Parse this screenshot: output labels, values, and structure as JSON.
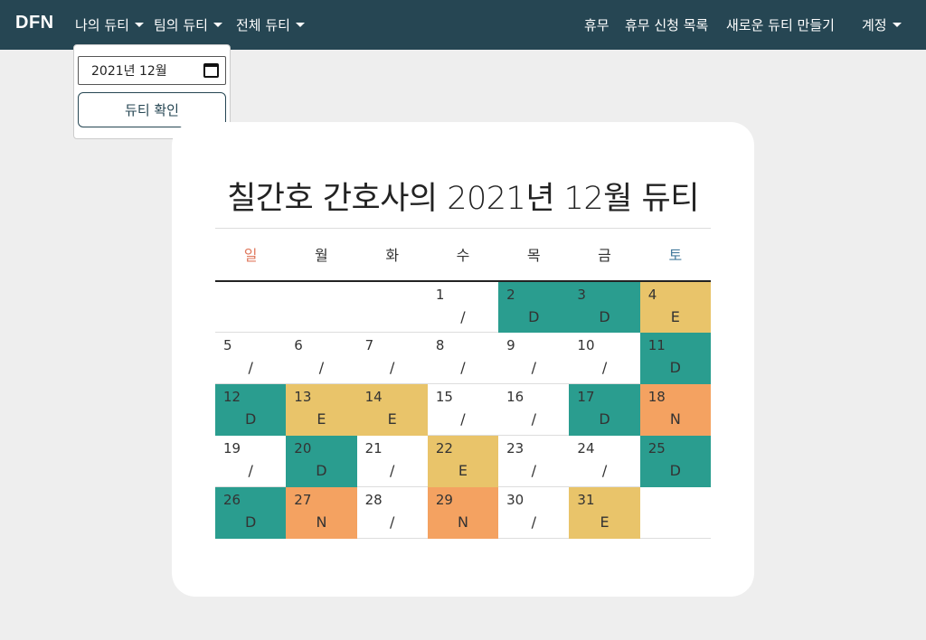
{
  "nav": {
    "brand": "DFN",
    "menus": [
      "나의 듀티",
      "팀의 듀티",
      "전체 듀티"
    ],
    "right_links": [
      "휴무",
      "휴무 신청 목록",
      "새로운 듀티 만들기"
    ],
    "account": "계정"
  },
  "dropdown": {
    "date_value": "2021년 12월",
    "button": "듀티 확인"
  },
  "calendar": {
    "title": "칠간호 간호사의 2021년 12월 듀티",
    "weekdays": [
      "일",
      "월",
      "화",
      "수",
      "목",
      "금",
      "토"
    ],
    "weeks": [
      [
        null,
        null,
        null,
        {
          "day": "1",
          "duty": "/"
        },
        {
          "day": "2",
          "duty": "D"
        },
        {
          "day": "3",
          "duty": "D"
        },
        {
          "day": "4",
          "duty": "E"
        }
      ],
      [
        {
          "day": "5",
          "duty": "/"
        },
        {
          "day": "6",
          "duty": "/"
        },
        {
          "day": "7",
          "duty": "/"
        },
        {
          "day": "8",
          "duty": "/"
        },
        {
          "day": "9",
          "duty": "/"
        },
        {
          "day": "10",
          "duty": "/"
        },
        {
          "day": "11",
          "duty": "D"
        }
      ],
      [
        {
          "day": "12",
          "duty": "D"
        },
        {
          "day": "13",
          "duty": "E"
        },
        {
          "day": "14",
          "duty": "E"
        },
        {
          "day": "15",
          "duty": "/"
        },
        {
          "day": "16",
          "duty": "/"
        },
        {
          "day": "17",
          "duty": "D"
        },
        {
          "day": "18",
          "duty": "N"
        }
      ],
      [
        {
          "day": "19",
          "duty": "/"
        },
        {
          "day": "20",
          "duty": "D"
        },
        {
          "day": "21",
          "duty": "/"
        },
        {
          "day": "22",
          "duty": "E"
        },
        {
          "day": "23",
          "duty": "/"
        },
        {
          "day": "24",
          "duty": "/"
        },
        {
          "day": "25",
          "duty": "D"
        }
      ],
      [
        {
          "day": "26",
          "duty": "D"
        },
        {
          "day": "27",
          "duty": "N"
        },
        {
          "day": "28",
          "duty": "/"
        },
        {
          "day": "29",
          "duty": "N"
        },
        {
          "day": "30",
          "duty": "/"
        },
        {
          "day": "31",
          "duty": "E"
        },
        null
      ]
    ]
  },
  "colors": {
    "navbar": "#264653",
    "duty_D": "#2a9d8f",
    "duty_E": "#e9c46a",
    "duty_N": "#f4a261",
    "sunday": "#e07a5f",
    "saturday": "#457b9d"
  }
}
